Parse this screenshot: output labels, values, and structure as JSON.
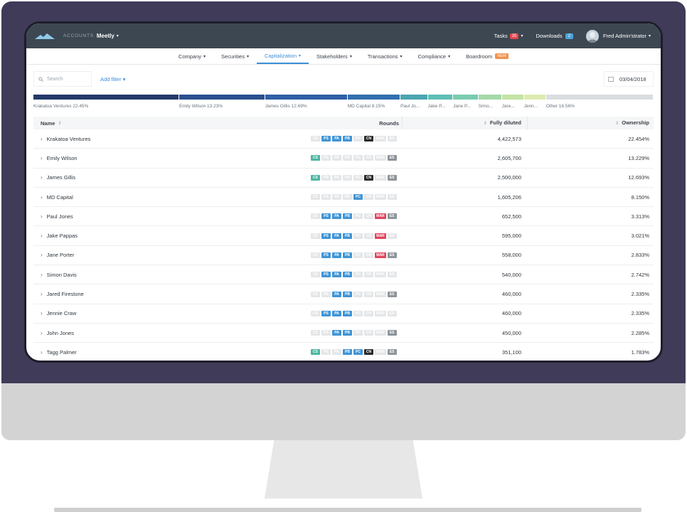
{
  "topbar": {
    "accounts_label": "ACCOUNTS",
    "account_name": "Meetly",
    "tasks_label": "Tasks",
    "tasks_count": "35",
    "downloads_label": "Downloads",
    "downloads_count": "2",
    "user_name": "Fred Admin'strator"
  },
  "nav": {
    "items": [
      {
        "label": "Company",
        "active": false,
        "caret": true
      },
      {
        "label": "Securities",
        "active": false,
        "caret": true
      },
      {
        "label": "Capitalization",
        "active": true,
        "caret": true
      },
      {
        "label": "Stakeholders",
        "active": false,
        "caret": true
      },
      {
        "label": "Transactions",
        "active": false,
        "caret": true
      },
      {
        "label": "Compliance",
        "active": false,
        "caret": true
      },
      {
        "label": "Boardroom",
        "active": false,
        "caret": false,
        "badge": "NEW"
      }
    ]
  },
  "filters": {
    "search_placeholder": "Search",
    "add_filter_label": "Add filter",
    "date": "03/04/2018"
  },
  "ownership_bar": {
    "segments": [
      {
        "label": "Krakatoa Ventures 22.45%",
        "share": 22.45,
        "color": "#243a6b"
      },
      {
        "label": "Emily Wilson 13.23%",
        "share": 13.23,
        "color": "#2b4f8f"
      },
      {
        "label": "James Gillis 12.69%",
        "share": 12.69,
        "color": "#2f5fa6"
      },
      {
        "label": "MD Capital 8.15%",
        "share": 8.15,
        "color": "#326fae"
      },
      {
        "label": "Paul Jo...",
        "share": 4.2,
        "color": "#4aa6b0"
      },
      {
        "label": "Jake P...",
        "share": 3.9,
        "color": "#5fbfb4"
      },
      {
        "label": "Jane P...",
        "share": 3.9,
        "color": "#7bcbb0"
      },
      {
        "label": "Simo...",
        "share": 3.6,
        "color": "#a4d9a8"
      },
      {
        "label": "Jare...",
        "share": 3.4,
        "color": "#c3e4a4"
      },
      {
        "label": "Jenn...",
        "share": 3.4,
        "color": "#dcebb0"
      },
      {
        "label": "Other 16.56%",
        "share": 16.56,
        "color": "#dadde0"
      }
    ]
  },
  "table": {
    "headers": {
      "name": "Name",
      "rounds": "Rounds",
      "fully_diluted": "Fully diluted",
      "ownership": "Ownership"
    },
    "rows": [
      {
        "name": "Krakatoa Ventures",
        "fully_diluted": "4,422,573",
        "ownership": "22.454%",
        "rounds": [
          0,
          1,
          1,
          1,
          0,
          2,
          0,
          0
        ]
      },
      {
        "name": "Emily Wilson",
        "fully_diluted": "2,605,700",
        "ownership": "13.229%",
        "rounds": [
          1,
          0,
          0,
          0,
          0,
          0,
          0,
          1
        ]
      },
      {
        "name": "James Gillis",
        "fully_diluted": "2,500,000",
        "ownership": "12.693%",
        "rounds": [
          1,
          0,
          0,
          0,
          0,
          2,
          0,
          1
        ]
      },
      {
        "name": "MD Capital",
        "fully_diluted": "1,605,206",
        "ownership": "8.150%",
        "rounds": [
          0,
          0,
          0,
          0,
          1,
          0,
          0,
          0
        ]
      },
      {
        "name": "Paul Jones",
        "fully_diluted": "652,500",
        "ownership": "3.313%",
        "rounds": [
          0,
          1,
          1,
          1,
          0,
          0,
          1,
          1
        ]
      },
      {
        "name": "Jake Pappas",
        "fully_diluted": "595,000",
        "ownership": "3.021%",
        "rounds": [
          0,
          1,
          1,
          1,
          0,
          0,
          1,
          0
        ]
      },
      {
        "name": "Jane Porter",
        "fully_diluted": "558,000",
        "ownership": "2.833%",
        "rounds": [
          0,
          1,
          1,
          1,
          0,
          0,
          1,
          1
        ]
      },
      {
        "name": "Simon Davis",
        "fully_diluted": "540,000",
        "ownership": "2.742%",
        "rounds": [
          0,
          1,
          1,
          1,
          0,
          0,
          0,
          0
        ]
      },
      {
        "name": "Jared Firestone",
        "fully_diluted": "460,000",
        "ownership": "2.335%",
        "rounds": [
          0,
          0,
          1,
          1,
          0,
          0,
          0,
          1
        ]
      },
      {
        "name": "Jennie Craw",
        "fully_diluted": "460,000",
        "ownership": "2.335%",
        "rounds": [
          0,
          1,
          1,
          1,
          0,
          0,
          0,
          0
        ]
      },
      {
        "name": "John Jones",
        "fully_diluted": "450,000",
        "ownership": "2.285%",
        "rounds": [
          0,
          0,
          1,
          1,
          0,
          0,
          0,
          1
        ]
      },
      {
        "name": "Tagg Palmer",
        "fully_diluted": "351,100",
        "ownership": "1.783%",
        "rounds": [
          1,
          0,
          0,
          1,
          1,
          2,
          0,
          1
        ]
      }
    ]
  },
  "round_chips": {
    "labels": [
      "CS",
      "PS",
      "PA",
      "PB",
      "PC",
      "CN",
      "WAR",
      "ES"
    ],
    "active_colors": [
      "#4db6a2",
      "#3f95d6",
      "#3f95d6",
      "#3f95d6",
      "#3f95d6",
      "#2b2b2b",
      "#e0455d",
      "#8d949a"
    ],
    "inactive_color": "#e4e6e8"
  }
}
